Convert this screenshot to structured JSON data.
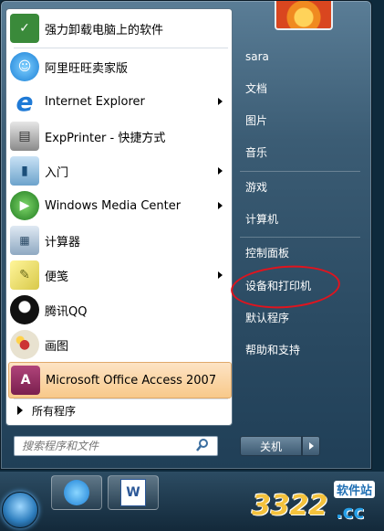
{
  "left_menu": {
    "items": [
      {
        "label": "强力卸载电脑上的软件",
        "icon": "uninstall-icon",
        "submenu": false
      },
      {
        "label": "阿里旺旺卖家版",
        "icon": "aliwangwang-icon",
        "submenu": false
      },
      {
        "label": "Internet Explorer",
        "icon": "internet-explorer-icon",
        "submenu": true
      },
      {
        "label": "ExpPrinter - 快捷方式",
        "icon": "printer-icon",
        "submenu": false
      },
      {
        "label": "入门",
        "icon": "getting-started-icon",
        "submenu": true
      },
      {
        "label": "Windows Media Center",
        "icon": "media-center-icon",
        "submenu": true
      },
      {
        "label": "计算器",
        "icon": "calculator-icon",
        "submenu": false
      },
      {
        "label": "便笺",
        "icon": "sticky-notes-icon",
        "submenu": true
      },
      {
        "label": "腾讯QQ",
        "icon": "qq-penguin-icon",
        "submenu": false
      },
      {
        "label": "画图",
        "icon": "paint-palette-icon",
        "submenu": false
      },
      {
        "label": "Microsoft Office Access 2007",
        "icon": "access-icon",
        "submenu": false,
        "highlighted": true
      }
    ],
    "all_programs": "所有程序",
    "search_placeholder": "搜索程序和文件"
  },
  "right_menu": {
    "items": [
      "sara",
      "文档",
      "图片",
      "音乐",
      "游戏",
      "计算机",
      "控制面板",
      "设备和打印机",
      "默认程序",
      "帮助和支持"
    ],
    "annotated_item": "设备和打印机",
    "shutdown_label": "关机"
  },
  "watermark": {
    "number": "3322",
    "top_text": "软件站",
    "suffix": ".cc"
  },
  "colors": {
    "highlight": "#f8c98a",
    "annotation_ring": "#e0141e",
    "menu_bg": "#2a4a62"
  }
}
